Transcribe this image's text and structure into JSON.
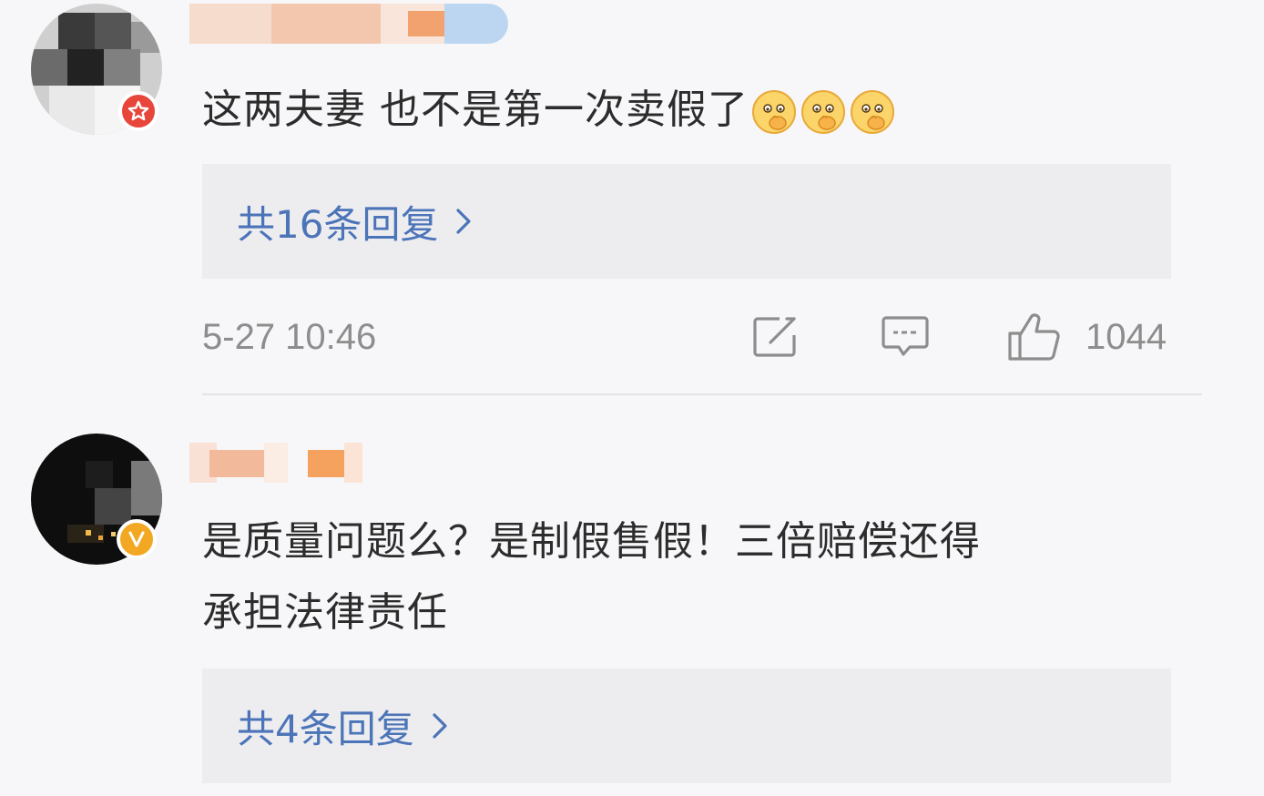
{
  "comments": [
    {
      "text": "这两夫妻 也不是第一次卖假了",
      "emoji_icons": [
        "shy-face-emoji",
        "shy-face-emoji",
        "shy-face-emoji"
      ],
      "badge": {
        "icon": "star-badge-icon",
        "color": "#e8463b"
      },
      "replies_label": "共16条回复",
      "timestamp": "5-27 10:46",
      "like_count": "1044",
      "actions": [
        "share-icon",
        "comment-icon",
        "thumbs-up-icon"
      ]
    },
    {
      "text_line1": "是质量问题么？是制假售假！三倍赔偿还得",
      "text_line2": "承担法律责任",
      "badge": {
        "icon": "v-verified-badge-icon",
        "color": "#f2a822"
      },
      "replies_label": "共4条回复"
    }
  ],
  "colors": {
    "background": "#f7f7f9",
    "reply_box": "#ededf0",
    "link": "#4c74b8",
    "meta": "#8d8d8d"
  }
}
